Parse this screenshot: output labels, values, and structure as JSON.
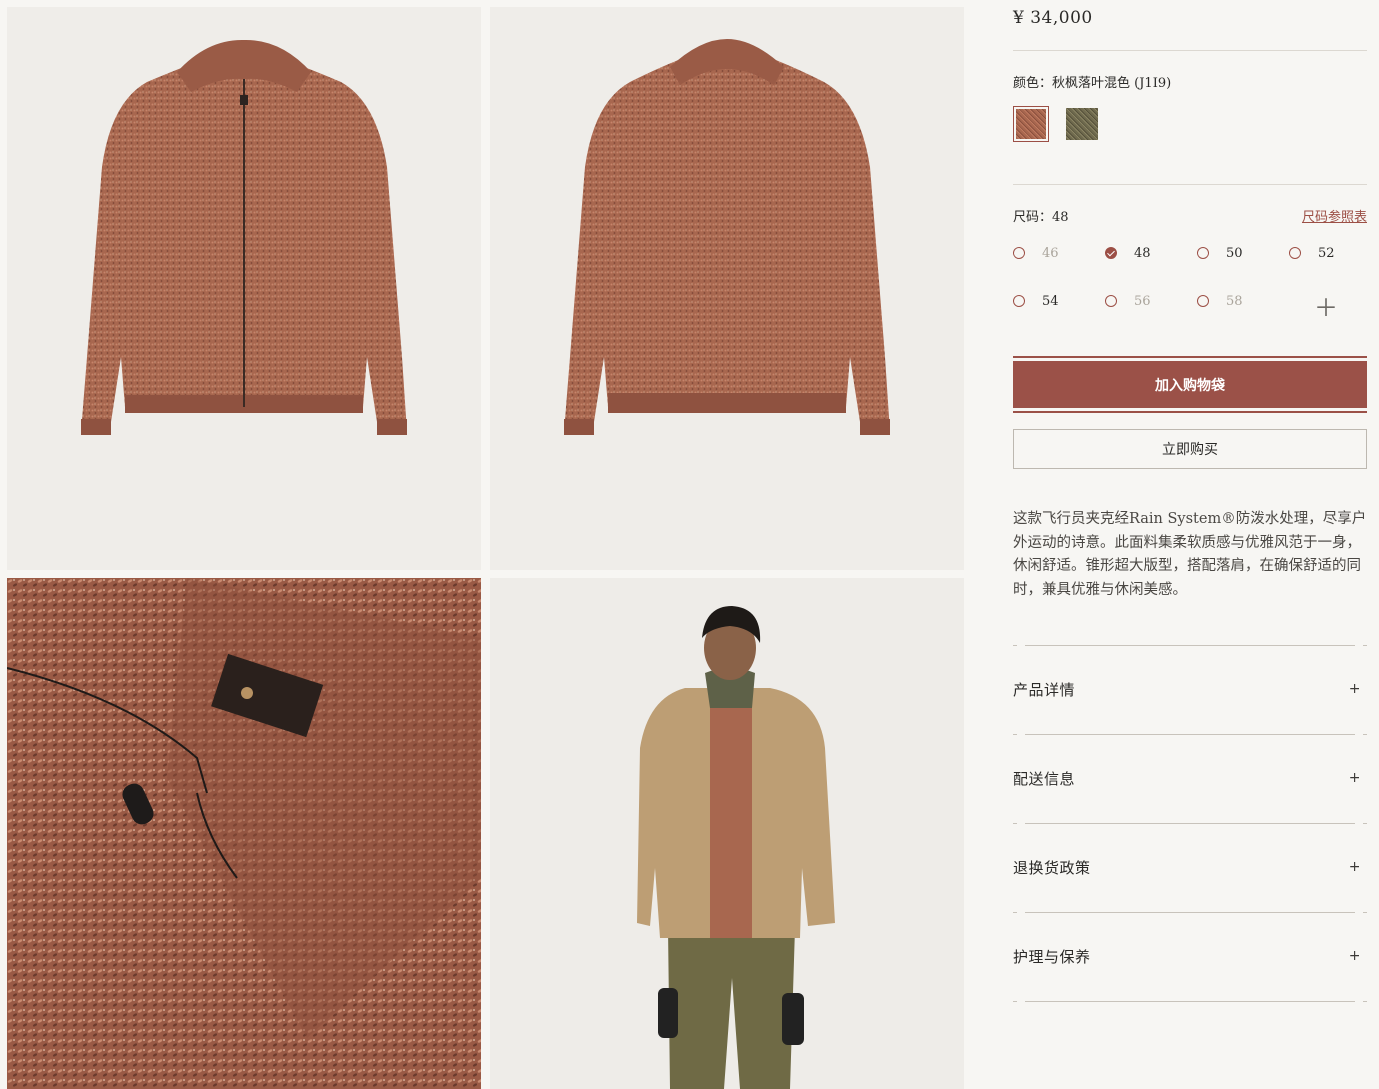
{
  "product": {
    "price": "¥ 34,000",
    "color_label": "颜色：",
    "color_value": "秋枫落叶混色 (J1I9)",
    "swatches": [
      {
        "name": "autumn-leaf-melange",
        "color": "#a8674f",
        "selected": true
      },
      {
        "name": "olive-melange",
        "color": "#6f6a4e",
        "selected": false
      }
    ],
    "size_label": "尺码：",
    "size_value": "48",
    "size_guide": "尺码参照表",
    "sizes": [
      {
        "label": "46",
        "available": false,
        "selected": false
      },
      {
        "label": "48",
        "available": true,
        "selected": true
      },
      {
        "label": "50",
        "available": true,
        "selected": false
      },
      {
        "label": "52",
        "available": true,
        "selected": false
      },
      {
        "label": "54",
        "available": true,
        "selected": false
      },
      {
        "label": "56",
        "available": false,
        "selected": false
      },
      {
        "label": "58",
        "available": false,
        "selected": false
      }
    ],
    "more_sizes_icon": "plus-icon",
    "add_to_bag": "加入购物袋",
    "buy_now": "立即购买",
    "description": "这款飞行员夹克经Rain System®防泼水处理，尽享户外运动的诗意。此面料集柔软质感与优雅风范于一身，休闲舒适。锥形超大版型，搭配落肩，在确保舒适的同时，兼具优雅与休闲美感。"
  },
  "accordion": [
    {
      "label": "产品详情",
      "icon": "plus-icon"
    },
    {
      "label": "配送信息",
      "icon": "plus-icon"
    },
    {
      "label": "退换货政策",
      "icon": "plus-icon"
    },
    {
      "label": "护理与保养",
      "icon": "plus-icon"
    }
  ],
  "colors": {
    "accent": "#9b5148",
    "background": "#f7f6f3",
    "sweater": "#a8674f"
  }
}
